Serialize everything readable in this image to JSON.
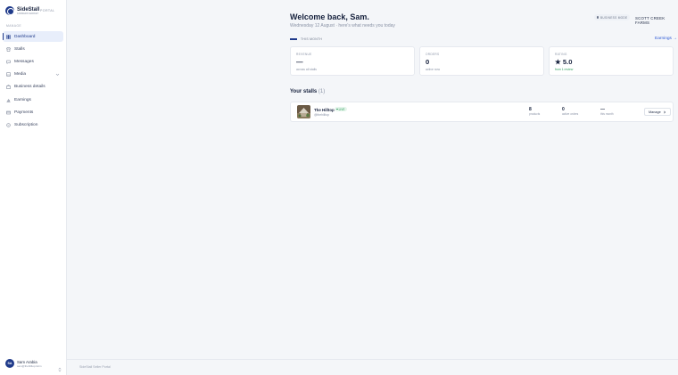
{
  "brand": {
    "name": "SideStall",
    "tagline": "FARMERS MARKET",
    "portal_label": "PORTAL"
  },
  "sidebar": {
    "section_label": "MANAGE",
    "items": [
      {
        "label": "Dashboard",
        "icon": "grid-icon",
        "active": true
      },
      {
        "label": "Stalls",
        "icon": "store-icon"
      },
      {
        "label": "Messages",
        "icon": "chat-icon"
      },
      {
        "label": "Media",
        "icon": "image-icon",
        "expandable": true
      },
      {
        "label": "Business details",
        "icon": "briefcase-icon"
      },
      {
        "label": "Earnings",
        "icon": "chart-icon"
      },
      {
        "label": "Payments",
        "icon": "card-icon"
      },
      {
        "label": "Subscription",
        "icon": "badge-icon"
      }
    ]
  },
  "user": {
    "initials": "SA",
    "name": "Sam Arabia",
    "email": "sam@thehilltop.farm"
  },
  "header": {
    "title": "Welcome back, Sam.",
    "subtitle": "Wednesday 12 August · here's what needs you today",
    "badge": "BUSINESS MODE",
    "business_name": "SCOTT CREEK FARMS"
  },
  "period": {
    "label": "THIS MONTH",
    "earnings_link": "Earnings →"
  },
  "cards": [
    {
      "label": "REVENUE",
      "value": "—",
      "sub": "across all stalls",
      "sub_color": "#8a93a6"
    },
    {
      "label": "ORDERS",
      "value": "0",
      "sub": "active now",
      "sub_color": "#8a93a6"
    },
    {
      "label": "RATING",
      "value": "★ 5.0",
      "sub": "from 1 review",
      "sub_color": "#2e9e5b"
    }
  ],
  "stalls": {
    "title": "Your stalls",
    "count": "(1)",
    "items": [
      {
        "name": "The Hilltop",
        "status": "LIVE",
        "handle": "@thehilltop",
        "stats": [
          {
            "value": "8",
            "label": "products"
          },
          {
            "value": "0",
            "label": "active orders"
          },
          {
            "value": "—",
            "label": "this month"
          }
        ],
        "manage_label": "Manage"
      }
    ]
  },
  "footer": {
    "text": "SideStall Seller Portal"
  }
}
